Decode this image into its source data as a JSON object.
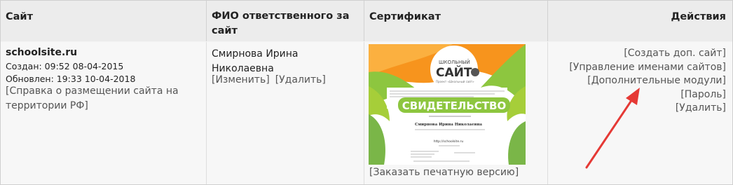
{
  "columns": {
    "site": "Сайт",
    "owner": "ФИО ответственного за сайт",
    "certificate": "Сертификат",
    "actions": "Действия"
  },
  "row": {
    "site_name": "schoolsite.ru",
    "created": "Создан: 09:52 08-04-2015",
    "updated": "Обновлен: 19:33 10-04-2018",
    "help_link": "[Справка о размещении сайта на территории РФ]",
    "owner_name": "Смирнова Ирина Николаевна",
    "owner_edit": "[Изменить]",
    "owner_delete": "[Удалить]",
    "certificate": {
      "logo_top": "ШКОЛЬНЫЙ",
      "logo_main": "САЙТ",
      "logo_tag": "Проект «Школьный сайт»",
      "heading": "СВИДЕТЕЛЬСТВО",
      "person": "Смирнова Ирина Николаевна",
      "url": "http://schoolsite.ru"
    },
    "order_print": "[Заказать печатную версию]",
    "actions": {
      "create": "[Создать доп. сайт]",
      "names": "[Управление именами сайтов]",
      "modules": "[Дополнительные модули]",
      "password": "[Пароль]",
      "delete": "[Удалить]"
    }
  },
  "colors": {
    "arrow": "#e53935",
    "cert_green": "#8dc63f",
    "cert_orange": "#f7941d"
  }
}
